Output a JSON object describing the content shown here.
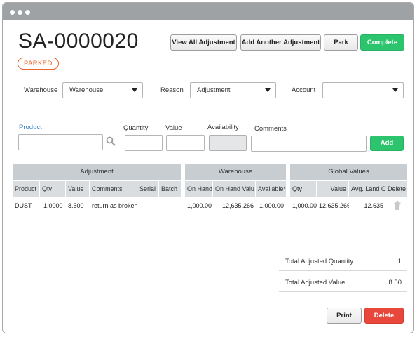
{
  "document": {
    "number": "SA-0000020",
    "status": "PARKED"
  },
  "actions": {
    "view_all": "View All Adjustment",
    "add_another": "Add Another Adjustment",
    "park": "Park",
    "complete": "Complete"
  },
  "filters": {
    "warehouse_label": "Warehouse",
    "warehouse_value": "Warehouse",
    "reason_label": "Reason",
    "reason_value": "Adjustment",
    "account_label": "Account",
    "account_value": ""
  },
  "entry": {
    "product_label": "Product",
    "quantity_label": "Quantity",
    "value_label": "Value",
    "availability_label": "Availability",
    "comments_label": "Comments",
    "add_label": "Add"
  },
  "table": {
    "groups": {
      "adjustment": "Adjustment",
      "warehouse": "Warehouse",
      "global": "Global Values"
    },
    "columns": {
      "product": "Product",
      "qty": "Qty",
      "value": "Value",
      "comments": "Comments",
      "serial": "Serial",
      "batch": "Batch",
      "on_hand": "On Hand",
      "on_hand_value": "On Hand Valu",
      "available": "Available*",
      "g_qty": "Qty",
      "g_value": "Value",
      "avg_land": "Avg. Land C",
      "delete": "Delete"
    },
    "rows": [
      {
        "product": "DUST",
        "qty": "1.0000",
        "value": "8.500",
        "comments": "return as broken",
        "serial": "",
        "batch": "",
        "on_hand": "1,000.00",
        "on_hand_value": "12,635.266",
        "available": "1,000.00",
        "g_qty": "1,000.00",
        "g_value": "12,635.266",
        "avg_land": "12.635"
      }
    ]
  },
  "totals": {
    "qty_label": "Total Adjusted Quantity",
    "qty_value": "1",
    "value_label": "Total Adjusted Value",
    "value_value": "8.50"
  },
  "footer": {
    "print": "Print",
    "delete": "Delete"
  },
  "colors": {
    "accent_green": "#2cc46d",
    "danger_red": "#e8473c",
    "status_orange": "#e8652b",
    "link_blue": "#2f7cc4"
  },
  "icons": {
    "search": "search-icon",
    "trash": "trash-icon",
    "caret": "chevron-down-icon"
  }
}
